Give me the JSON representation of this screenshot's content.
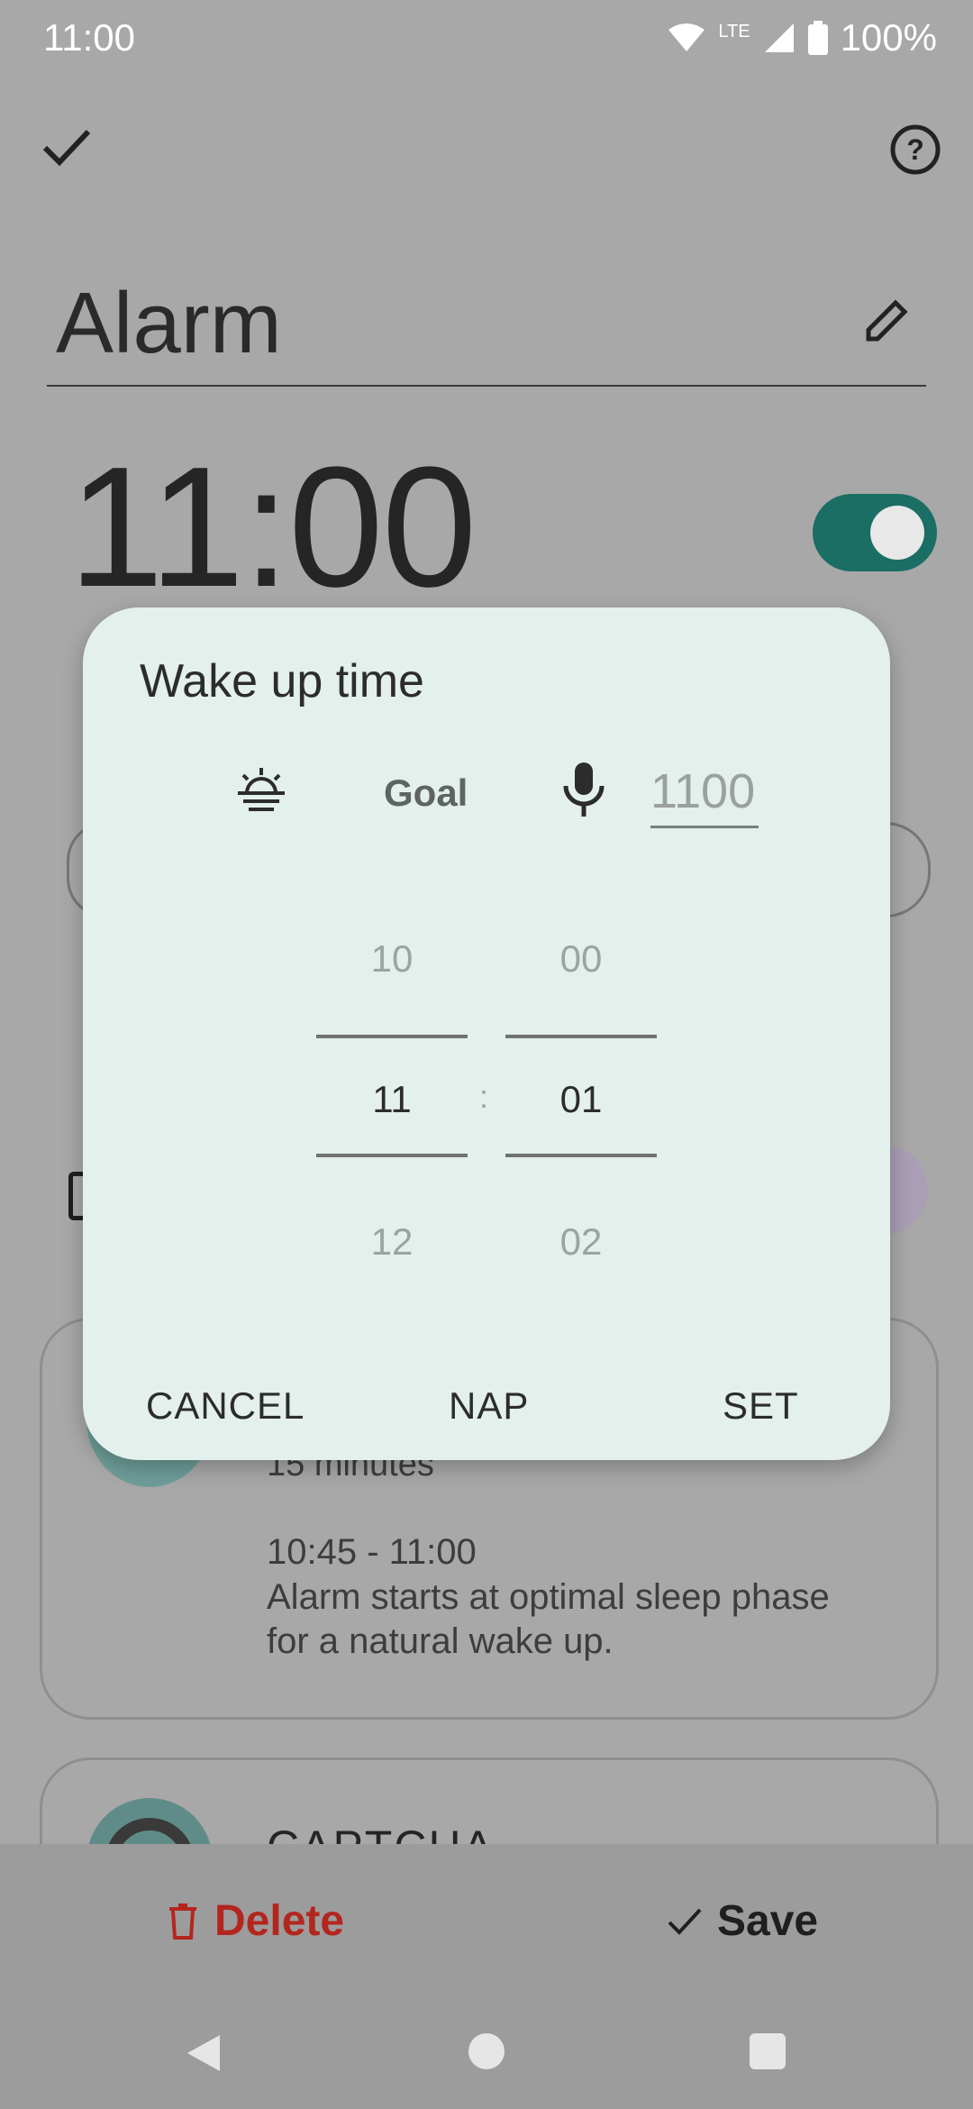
{
  "status_bar": {
    "time": "11:00",
    "network": "LTE",
    "battery": "100%"
  },
  "header": {
    "confirm_icon": "check-icon",
    "help_icon": "help-circle-icon"
  },
  "alarm": {
    "title": "Alarm",
    "time": "11:00",
    "enabled": true
  },
  "smart_wakeup_card": {
    "subtitle": "15 minutes",
    "window": "10:45 - 11:00",
    "desc_line1": "Alarm starts at optimal sleep phase",
    "desc_line2": "for a natural wake up."
  },
  "captcha_card": {
    "title": "CAPTCHA"
  },
  "bottom_actions": {
    "delete_label": "Delete",
    "save_label": "Save"
  },
  "dialog": {
    "title": "Wake up time",
    "goal_label": "Goal",
    "voice_placeholder": "1100",
    "picker": {
      "hour_prev": "10",
      "hour": "11",
      "hour_next": "12",
      "separator": ":",
      "minute_prev": "00",
      "minute": "01",
      "minute_next": "02"
    },
    "buttons": {
      "cancel": "CANCEL",
      "nap": "NAP",
      "set": "SET"
    }
  },
  "colors": {
    "accent": "#1b6e63",
    "dialog_bg": "#e3f0ec",
    "delete": "#b3261e"
  }
}
